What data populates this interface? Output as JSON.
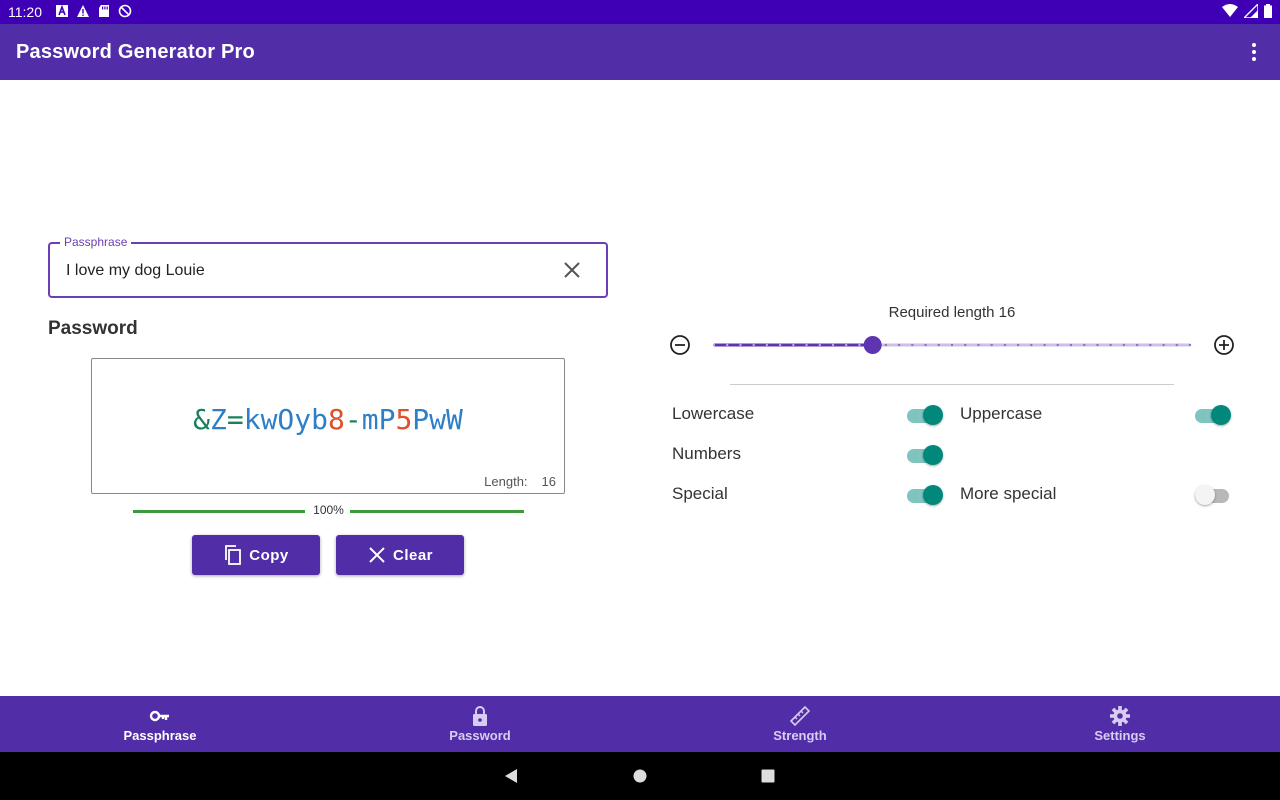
{
  "status_bar": {
    "time": "11:20"
  },
  "app": {
    "title": "Password Generator Pro"
  },
  "passphrase": {
    "label": "Passphrase",
    "value": "I love my dog Louie"
  },
  "password": {
    "section_title": "Password",
    "chars": [
      "&",
      "Z",
      "=",
      "k",
      "w",
      "O",
      "y",
      "b",
      "8",
      "-",
      "m",
      "P",
      "5",
      "P",
      "w",
      "W"
    ],
    "length_label": "Length:",
    "length_value": "16",
    "strength_percent": "100%"
  },
  "buttons": {
    "copy": "Copy",
    "clear": "Clear"
  },
  "slider": {
    "label": "Required length 16",
    "value": 16,
    "min": 4,
    "max": 40
  },
  "options": {
    "lowercase": {
      "label": "Lowercase",
      "on": true
    },
    "uppercase": {
      "label": "Uppercase",
      "on": true
    },
    "numbers": {
      "label": "Numbers",
      "on": true
    },
    "special": {
      "label": "Special",
      "on": true
    },
    "more_special": {
      "label": "More special",
      "on": false
    }
  },
  "bottom_nav": [
    {
      "label": "Passphrase",
      "icon": "key-icon",
      "active": true
    },
    {
      "label": "Password",
      "icon": "lock-icon",
      "active": false
    },
    {
      "label": "Strength",
      "icon": "ruler-icon",
      "active": false
    },
    {
      "label": "Settings",
      "icon": "gear-icon",
      "active": false
    }
  ],
  "colors": {
    "primary": "#512da8",
    "status_bar": "#3f00b5",
    "accent": "#00897b",
    "strength": "#3c9a3c"
  }
}
